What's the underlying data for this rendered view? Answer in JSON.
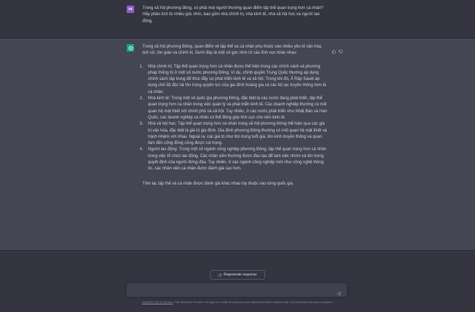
{
  "user": {
    "avatar_initials": "HI",
    "message": "Trong xã hội phương đông, có phải mọi người thường quan điểm tập thể quan trọng hơn cá nhân? Hãy phân tích từ nhiều góc nhìn, bao gồm nhà chính trị, nhà kinh tế, nhà xã hội học và người lao động."
  },
  "assistant": {
    "intro": "Trong xã hội phương Đông, quan điểm về tập thể và cá nhân phụ thuộc vào nhiều yếu tố văn hóa, lịch sử, tôn giáo và chính trị. Dưới đây là một số góc nhìn từ các lĩnh vực khác nhau:",
    "items": [
      {
        "num": "1.",
        "text": "Nhà chính trị: Tập thể quan trọng hơn cá nhân được thể hiện trong các chính sách và phương pháp thống trị ở một số nước phương Đông. Ví dụ, chính quyền Trung Quốc thường áp dụng chính sách tập trung để thúc đẩy sự phát triển kinh tế và xã hội. Trong khi đó, Ả Rập Saudi áp dụng chế độ độc tài tôn trọng quyền lực của gia đình hoàng gia và các bộ lạc truyền thống hơn là cá nhân."
      },
      {
        "num": "2.",
        "text": "Nhà kinh tế: Trong một số quốc gia phương Đông, đặc biệt là các nước đang phát triển, tập thể quan trọng hơn cá nhân trong việc quản lý và phát triển kinh tế. Các doanh nghiệp thường có mối quan hệ mật thiết với chính phủ và xã hội. Tuy nhiên, ở các nước phát triển như Nhật Bản và Hàn Quốc, các doanh nghiệp cá nhân có thể đóng góp tích cực cho nền kinh tế."
      },
      {
        "num": "3.",
        "text": "Nhà xã hội học: Tập thể quan trọng hơn cá nhân trong xã hội phương Đông thể hiện qua các giá trị văn hóa, đặc biệt là giá trị gia đình. Gia đình phương Đông thường có mối quan hệ mật thiết và trách nhiệm với nhau. Ngoài ra, các giá trị như tôn trọng tuổi già, tôn kính truyền thống và quan tâm đến cộng đồng cũng được coi trọng."
      },
      {
        "num": "4.",
        "text": "Người lao động: Trong một số ngành công nghiệp phương Đông, tập thể quan trọng hơn cá nhân trong việc tổ chức lao động. Các nhân viên thường được đào tạo để làm việc nhóm và tôn trọng quyết định của người đứng đầu. Tuy nhiên, ở các ngành công nghiệp mới như công nghệ thông tin, các nhân viên cá nhân được đánh giá cao hơn."
      }
    ],
    "closing": "Tóm lại, tập thể và cá nhân được đánh giá khác nhau tùy thuộc vào từng quốc gia,"
  },
  "controls": {
    "regenerate_label": "Regenerate response",
    "input_placeholder": "",
    "footer_link": "ChatGPT Feb 13 Version",
    "footer_text": ". Free Research Preview. Our goal is to make AI systems more natural and safe to interact with. Your feedback will help us improve."
  },
  "colors": {
    "background": "#343541",
    "assistant_row": "#444654",
    "assistant_avatar": "#10a37f",
    "user_avatar": "#8e5ac8",
    "input": "#40414f"
  },
  "icons": [
    "openai-logo-icon",
    "thumbs-up-icon",
    "thumbs-down-icon",
    "refresh-icon",
    "send-icon"
  ]
}
